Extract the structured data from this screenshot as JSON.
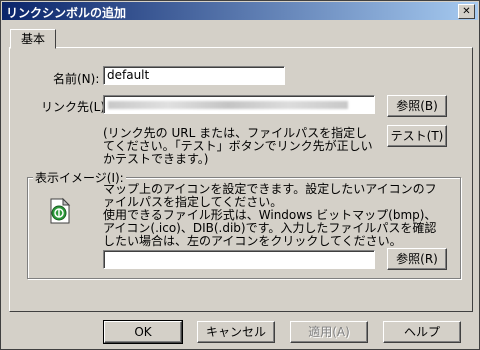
{
  "window": {
    "title": "リンクシンボルの追加",
    "close_glyph": "✕"
  },
  "tab": {
    "label": "基本"
  },
  "name": {
    "label": "名前(N):",
    "value": "default"
  },
  "link": {
    "label": "リンク先(L):",
    "browse_label": "参照(B)"
  },
  "hint": {
    "text": "(リンク先の URL または、ファイルパスを指定してください。「テスト」ボタンでリンク先が正しいかテストできます。)",
    "test_label": "テスト(T)"
  },
  "image": {
    "group_label": "表示イメージ(I):",
    "desc1": "マップ上のアイコンを設定できます。設定したいアイコンのファイルパスを指定してください。",
    "desc2": "使用できるファイル形式は、Windows ビットマップ(bmp)、アイコン(.ico)、DIB(.dib)です。入力したファイルパスを確認したい場合は、左のアイコンをクリックしてください。",
    "path_value": "",
    "browse_label": "参照(R)",
    "icon": "green-document-icon"
  },
  "footer": {
    "ok": "OK",
    "cancel": "キャンセル",
    "apply": "適用(A)",
    "help": "ヘルプ"
  }
}
